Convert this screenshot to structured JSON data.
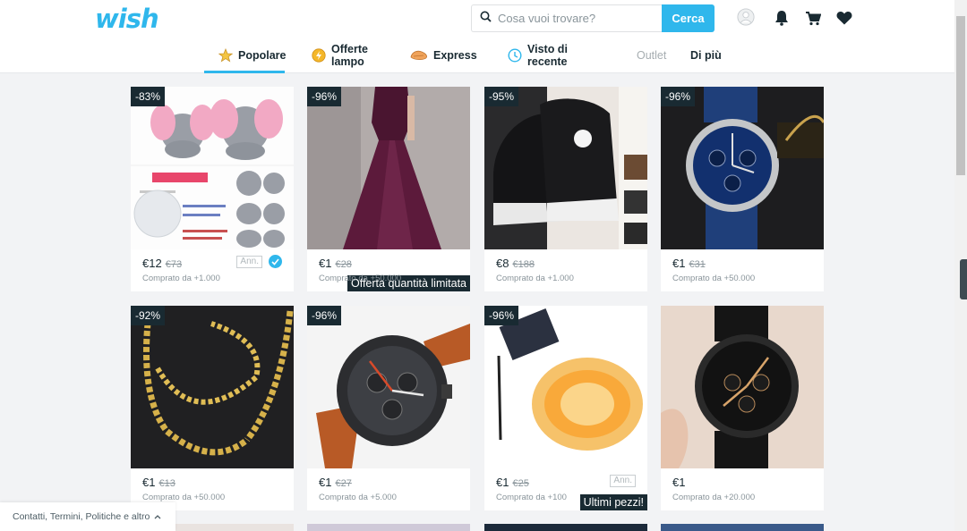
{
  "header": {
    "logo": "wish",
    "search_placeholder": "Cosa vuoi trovare?",
    "search_button": "Cerca"
  },
  "nav": [
    {
      "label": "Popolare",
      "icon": "star-icon",
      "active": true
    },
    {
      "label": "Offerte lampo",
      "icon": "flash-deal-icon"
    },
    {
      "label": "Express",
      "icon": "express-icon"
    },
    {
      "label": "Visto di recente",
      "icon": "clock-icon"
    },
    {
      "label": "Outlet",
      "icon": ""
    },
    {
      "label": "Di più",
      "icon": ""
    }
  ],
  "products": [
    {
      "badge": "-83%",
      "price": "€12",
      "old_price": "€73",
      "bought": "Comprato da +1.000",
      "ann": "Ann.",
      "verified": true,
      "overlay": "",
      "image": "elephant-plush"
    },
    {
      "badge": "-96%",
      "price": "€1",
      "old_price": "€28",
      "bought": "Comprato da +50.000",
      "ann": "",
      "verified": false,
      "overlay": "Offerta quantità limitata",
      "image": "purple-dress"
    },
    {
      "badge": "-95%",
      "price": "€8",
      "old_price": "€188",
      "bought": "Comprato da +1.000",
      "ann": "",
      "verified": false,
      "overlay": "",
      "image": "black-sneakers"
    },
    {
      "badge": "-96%",
      "price": "€1",
      "old_price": "€31",
      "bought": "Comprato da +50.000",
      "ann": "",
      "verified": false,
      "overlay": "",
      "image": "blue-watch"
    },
    {
      "badge": "-92%",
      "price": "€1",
      "old_price": "€13",
      "bought": "Comprato da +50.000",
      "ann": "",
      "verified": false,
      "overlay": "",
      "image": "gold-chain"
    },
    {
      "badge": "-96%",
      "price": "€1",
      "old_price": "€27",
      "bought": "Comprato da +5.000",
      "ann": "",
      "verified": false,
      "overlay": "",
      "image": "orange-strap-watch"
    },
    {
      "badge": "-96%",
      "price": "€1",
      "old_price": "€25",
      "bought": "Comprato da +100",
      "ann": "Ann.",
      "verified": false,
      "overlay": "Ultimi pezzi!",
      "image": "solar-string-lights"
    },
    {
      "badge": "",
      "price": "€1",
      "old_price": "",
      "bought": "Comprato da +20.000",
      "ann": "",
      "verified": false,
      "overlay": "",
      "image": "black-geneva-watch"
    }
  ],
  "footer": {
    "label": "Contatti, Termini, Politiche e altro"
  },
  "colors": {
    "accent": "#2fb7ec",
    "dark": "#192a32"
  }
}
